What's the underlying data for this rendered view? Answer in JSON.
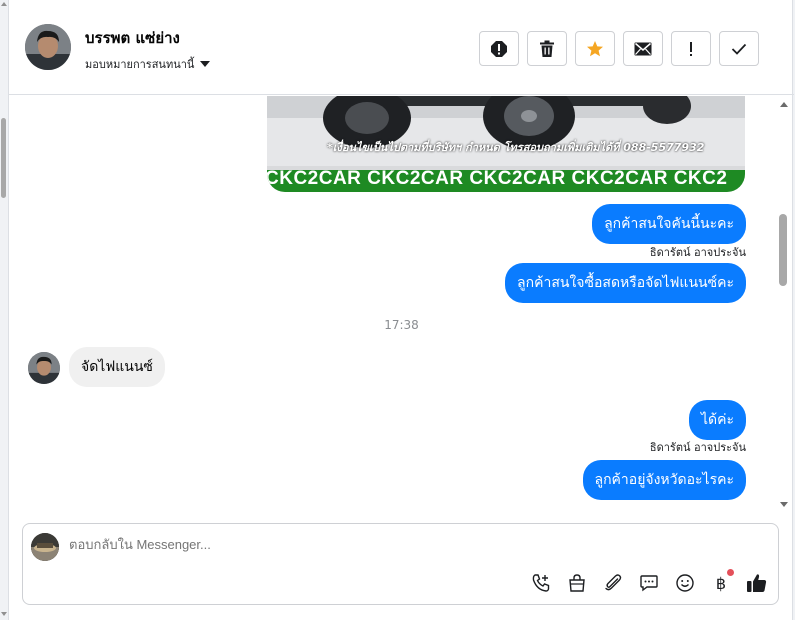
{
  "header": {
    "contact_name": "บรรพต แซ่ย่าง",
    "assign_label": "มอบหมายการสนทนานี้",
    "actions": [
      {
        "name": "spam-button",
        "icon": "exclamation-circle-icon"
      },
      {
        "name": "delete-button",
        "icon": "trash-icon"
      },
      {
        "name": "star-button",
        "icon": "star-icon"
      },
      {
        "name": "mark-unread-button",
        "icon": "envelope-icon"
      },
      {
        "name": "follow-up-button",
        "icon": "exclamation-icon"
      },
      {
        "name": "mark-done-button",
        "icon": "check-icon"
      }
    ]
  },
  "conversation": {
    "image_caption": "*เงื่อนไขเป็นไปตามที่บริษัทฯ กำหนด โทรสอบถามเพิ่มเติมได้ที่ 088-5577932",
    "image_banner": "CKC2CAR CKC2CAR CKC2CAR CKC2CAR CKC2",
    "messages": [
      {
        "text": "ลูกค้าสนใจคันนี้นะคะ"
      },
      {
        "sender": "ธิดารัตน์ อาจประจัน"
      },
      {
        "text": "ลูกค้าสนใจซื้อสดหรือจัดไฟแนนซ์คะ"
      },
      {
        "time": "17:38"
      },
      {
        "text": "จัดไฟแนนซ์"
      },
      {
        "text": "ได้ค่ะ"
      },
      {
        "sender": "ธิดารัตน์ อาจประจัน"
      },
      {
        "text": "ลูกค้าอยู่จังหวัดอะไรคะ"
      }
    ]
  },
  "composer": {
    "placeholder": "ตอบกลับใน Messenger...",
    "tools": [
      "add-call-icon",
      "shopping-bag-icon",
      "attachment-icon",
      "saved-reply-icon",
      "emoji-icon",
      "payment-icon",
      "like-icon"
    ],
    "payment_symbol": "฿"
  },
  "colors": {
    "outgoing_bubble": "#0a7cff",
    "incoming_bubble": "#f0f0f0",
    "star": "#f5a623",
    "notify_dot": "#e4505a"
  }
}
